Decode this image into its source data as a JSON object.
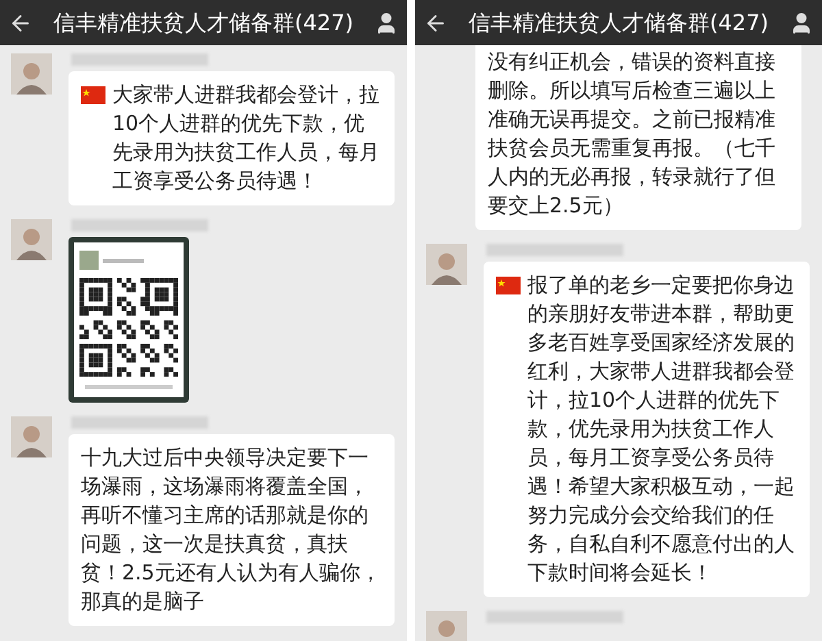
{
  "panels": [
    {
      "title": "信丰精准扶贫人才储备群(427)",
      "messages": [
        {
          "kind": "text",
          "flag": true,
          "text": "大家带人进群我都会登计，拉10个人进群的优先下款，优先录用为扶贫工作人员，每月工资享受公务员待遇！"
        },
        {
          "kind": "image"
        },
        {
          "kind": "text",
          "flag": false,
          "text": "十九大过后中央领导决定要下一场瀑雨，这场瀑雨将覆盖全国，再听不懂习主席的话那就是你的问题，这一次是扶真贫，真扶贫！2.5元还有人认为有人骗你，那真的是脑子"
        }
      ]
    },
    {
      "title": "信丰精准扶贫人才储备群(427)",
      "messages": [
        {
          "kind": "continuation",
          "flag": false,
          "text": "没有纠正机会，错误的资料直接删除。所以填写后检查三遍以上准确无误再提交。之前已报精准扶贫会员无需重复再报。（七千人内的无必再报，转录就行了但要交上2.5元）"
        },
        {
          "kind": "text",
          "flag": true,
          "text": "报了单的老乡一定要把你身边的亲朋好友带进本群，帮助更多老百姓享受国家经济发展的红利，大家带人进群我都会登计，拉10个人进群的优先下款，优先录用为扶贫工作人员，每月工资享受公务员待遇！希望大家积极互动，一起努力完成分会交给我们的任务，自私自利不愿意付出的人下款时间将会延长！"
        },
        {
          "kind": "stub"
        }
      ]
    }
  ]
}
